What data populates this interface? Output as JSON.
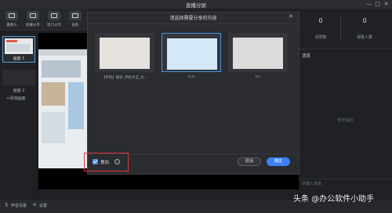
{
  "window": {
    "title": "直播分屏",
    "controls": [
      "—",
      "□",
      "✕"
    ]
  },
  "toolbar": {
    "items": [
      {
        "label": "摄像头",
        "icon": "camera-icon"
      },
      {
        "label": "屏幕分享",
        "icon": "screen-share-icon"
      },
      {
        "label": "窗口分享",
        "icon": "window-share-icon"
      },
      {
        "label": "投影",
        "icon": "projector-icon"
      }
    ]
  },
  "scenes": {
    "items": [
      {
        "label": "画面 1",
        "selected": true
      },
      {
        "label": "画面 2",
        "selected": false
      }
    ],
    "add_label": "+添加画面"
  },
  "right_panel": {
    "stats": [
      {
        "value": "0",
        "label": "点赞数"
      },
      {
        "value": "0",
        "label": "观看人数"
      }
    ],
    "messages_title": "消息",
    "messages_empty": "暂无消息",
    "input_placeholder": "请输入消息"
  },
  "dialog": {
    "title": "请选择需要分享的内容",
    "close": "✕",
    "cards": [
      {
        "label": "【手机】报价_手机大全_价..."
      },
      {
        "label": "1(1)"
      },
      {
        "label": "D:\\"
      }
    ],
    "checkbox": {
      "label": "叠加",
      "checked": true
    },
    "info": "i",
    "cancel_label": "取消",
    "ok_label": "确定"
  },
  "bottom_bar": {
    "audio_label": "声音设置",
    "settings_label": "设置"
  },
  "watermark": "头条 @办公软件小助手",
  "colors": {
    "accent": "#3b82f6",
    "highlight": "#e0383e",
    "background": "#1f2124"
  }
}
